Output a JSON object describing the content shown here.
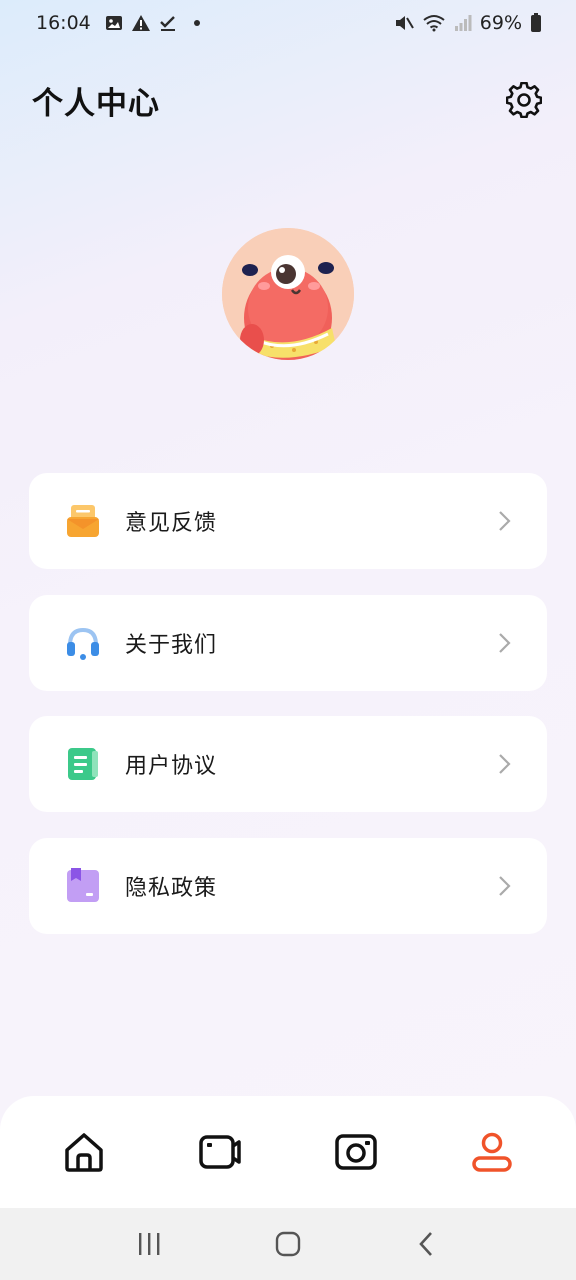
{
  "status_bar": {
    "time": "16:04",
    "battery": "69%",
    "left_icons": [
      "image-icon",
      "warning-icon",
      "checkmark-icon",
      "dot-icon"
    ],
    "right_icons": [
      "mute-icon",
      "wifi-icon",
      "signal-icon",
      "battery-icon"
    ]
  },
  "header": {
    "title": "个人中心",
    "settings_icon": "gear-icon"
  },
  "avatar": {
    "icon": "cyclops-monster-avatar"
  },
  "menu": {
    "items": [
      {
        "label": "意见反馈",
        "icon": "feedback-icon",
        "color": "#f7a531"
      },
      {
        "label": "关于我们",
        "icon": "headset-icon",
        "color": "#3c8de6"
      },
      {
        "label": "用户协议",
        "icon": "document-icon",
        "color": "#3cc98a"
      },
      {
        "label": "隐私政策",
        "icon": "privacy-icon",
        "color": "#a77df0"
      }
    ]
  },
  "tabbar": {
    "tabs": [
      {
        "icon": "home-icon",
        "active": false
      },
      {
        "icon": "video-camera-icon",
        "active": false
      },
      {
        "icon": "camera-icon",
        "active": false
      },
      {
        "icon": "profile-icon",
        "active": true
      }
    ],
    "active_color": "#f0532a"
  },
  "nav_bar": {
    "buttons": [
      "recent-apps-icon",
      "home-button-icon",
      "back-icon"
    ]
  }
}
